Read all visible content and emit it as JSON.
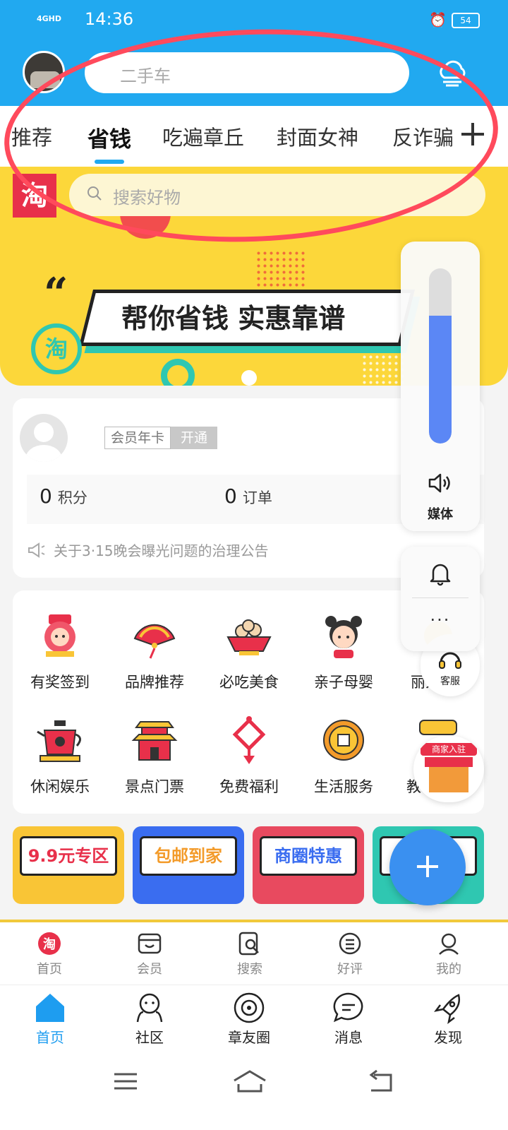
{
  "status_bar": {
    "signal": "4GHD",
    "time": "14:36",
    "battery": "54"
  },
  "header": {
    "search_placeholder": "二手车",
    "tabs": [
      {
        "label": "推荐"
      },
      {
        "label": "省钱",
        "active": true
      },
      {
        "label": "吃遍章丘"
      },
      {
        "label": "封面女神"
      },
      {
        "label": "反诈骗"
      }
    ]
  },
  "banner": {
    "logo": "淘",
    "search_placeholder": "搜索好物",
    "slogan": "帮你省钱 实惠靠谱",
    "badge": "淘"
  },
  "member": {
    "vip_label": "会员年卡",
    "vip_action": "开通",
    "points_value": "0",
    "points_label": "积分",
    "orders_value": "0",
    "orders_label": "订单",
    "notice": "关于3·15晚会曝光问题的治理公告"
  },
  "categories": [
    {
      "label": "有奖签到",
      "icon": "lucky-doll-icon"
    },
    {
      "label": "品牌推荐",
      "icon": "fan-icon"
    },
    {
      "label": "必吃美食",
      "icon": "food-bowl-icon"
    },
    {
      "label": "亲子母婴",
      "icon": "child-icon"
    },
    {
      "label": "丽人",
      "icon": "beauty-icon"
    },
    {
      "label": "休闲娱乐",
      "icon": "teapot-icon"
    },
    {
      "label": "景点门票",
      "icon": "pagoda-icon"
    },
    {
      "label": "免费福利",
      "icon": "chinese-knot-icon"
    },
    {
      "label": "生活服务",
      "icon": "coin-icon"
    },
    {
      "label": "教育",
      "icon": "education-icon"
    }
  ],
  "promos": [
    {
      "label": "9.9元专区",
      "color": "#f9c536"
    },
    {
      "label": "包邮到家",
      "color": "#3a6df0"
    },
    {
      "label": "商圈特惠",
      "color": "#e84a5f"
    },
    {
      "label": "商家入驻",
      "color": "#2fc7b1"
    }
  ],
  "volume_panel": {
    "label": "媒体",
    "level": 0.73,
    "more": "···"
  },
  "customer_service": {
    "label": "客服"
  },
  "merchant_badge": {
    "label": "商家入驻"
  },
  "fab": {
    "label": "+"
  },
  "web_nav": [
    {
      "label": "首页",
      "icon": "taobao-icon"
    },
    {
      "label": "会员",
      "icon": "member-card-icon"
    },
    {
      "label": "搜索",
      "icon": "search-doc-icon"
    },
    {
      "label": "好评",
      "icon": "smile-list-icon"
    },
    {
      "label": "我的",
      "icon": "user-icon"
    }
  ],
  "app_nav": [
    {
      "label": "首页",
      "icon": "home-icon",
      "active": true
    },
    {
      "label": "社区",
      "icon": "community-icon"
    },
    {
      "label": "章友圈",
      "icon": "planet-icon"
    },
    {
      "label": "消息",
      "icon": "message-icon"
    },
    {
      "label": "发现",
      "icon": "rocket-icon"
    }
  ],
  "colors": {
    "header_blue": "#21a9f0",
    "banner_yellow": "#fcd73a",
    "accent_red": "#e8304a",
    "annotation_red": "#ff4a5c",
    "active_blue": "#1e9df0"
  }
}
